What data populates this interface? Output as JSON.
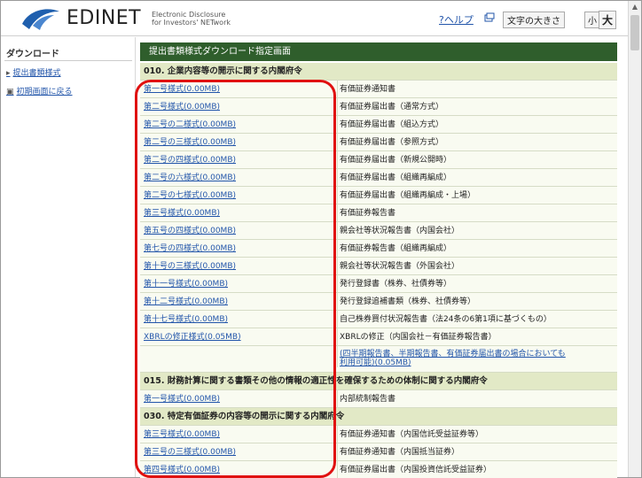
{
  "header": {
    "brand": "EDINET",
    "tagline_line1": "Electronic Disclosure",
    "tagline_line2": "for Investors' NETwork",
    "help_label": "?ヘルプ",
    "font_size_label": "文字の大きさ",
    "font_small": "小",
    "font_large": "大",
    "logo_color": "#1f5fae"
  },
  "sidebar": {
    "title": "ダウンロード",
    "items": [
      {
        "bullet": "▸",
        "label": "提出書類様式"
      },
      {
        "bullet": "▣",
        "label": "初期画面に戻る"
      }
    ]
  },
  "main": {
    "page_title": "提出書類様式ダウンロード指定画面",
    "accent_color": "#2f5e2c",
    "sections": [
      {
        "title": "010. 企業内容等の開示に関する内閣府令",
        "rows": [
          {
            "link": "第一号様式(0.00MB)",
            "desc": "有価証券通知書"
          },
          {
            "link": "第二号様式(0.00MB)",
            "desc": "有価証券届出書（通常方式）"
          },
          {
            "link": "第二号の二様式(0.00MB)",
            "desc": "有価証券届出書（組込方式）"
          },
          {
            "link": "第二号の三様式(0.00MB)",
            "desc": "有価証券届出書（参照方式）"
          },
          {
            "link": "第二号の四様式(0.00MB)",
            "desc": "有価証券届出書（新規公開時）"
          },
          {
            "link": "第二号の六様式(0.00MB)",
            "desc": "有価証券届出書（組織再編成）"
          },
          {
            "link": "第二号の七様式(0.00MB)",
            "desc": "有価証券届出書（組織再編成・上場）"
          },
          {
            "link": "第三号様式(0.00MB)",
            "desc": "有価証券報告書"
          },
          {
            "link": "第五号の四様式(0.00MB)",
            "desc": "親会社等状況報告書（内国会社）"
          },
          {
            "link": "第七号の四様式(0.00MB)",
            "desc": "有価証券報告書（組織再編成）"
          },
          {
            "link": "第十号の三様式(0.00MB)",
            "desc": "親会社等状況報告書（外国会社）"
          },
          {
            "link": "第十一号様式(0.00MB)",
            "desc": "発行登録書（株券、社債券等）"
          },
          {
            "link": "第十二号様式(0.00MB)",
            "desc": "発行登録追補書類（株券、社債券等）"
          },
          {
            "link": "第十七号様式(0.00MB)",
            "desc": "自己株券買付状況報告書（法24条の6第1項に基づくもの）"
          },
          {
            "link": "XBRLの修正様式(0.05MB)",
            "desc": "XBRLの修正（内国会社－有価証券報告書）"
          },
          {
            "link": "",
            "desc_link_1": "(四半期報告書、半期報告書、有価証券届出書の場合においても",
            "desc_link_2": "利用可能)(0.05MB)"
          }
        ]
      },
      {
        "title": "015. 財務計算に関する書類その他の情報の適正性を確保するための体制に関する内閣府令",
        "rows": [
          {
            "link": "第一号様式(0.00MB)",
            "desc": "内部統制報告書"
          }
        ]
      },
      {
        "title": "030. 特定有価証券の内容等の開示に関する内閣府令",
        "rows": [
          {
            "link": "第三号様式(0.00MB)",
            "desc": "有価証券通知書（内国信託受益証券等）"
          },
          {
            "link": "第三号の三様式(0.00MB)",
            "desc": "有価証券通知書（内国抵当証券）"
          },
          {
            "link": "第四号様式(0.00MB)",
            "desc": "有価証券届出書（内国投資信託受益証券）"
          }
        ]
      }
    ]
  }
}
